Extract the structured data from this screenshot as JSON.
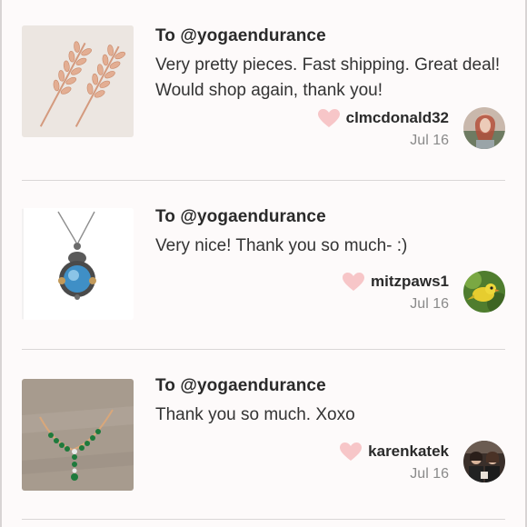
{
  "reviews": [
    {
      "to": "To @yogaendurance",
      "message": "Very pretty pieces. Fast shipping. Great deal! Would shop again, thank you!",
      "username": "clmcdonald32",
      "date": "Jul 16",
      "thumb_icon": "leaf-ear-cuff-earrings-image",
      "avatar_icon": "user-avatar-photo"
    },
    {
      "to": "To @yogaendurance",
      "message": "Very nice! Thank you so much- :)",
      "username": "mitzpaws1",
      "date": "Jul 16",
      "thumb_icon": "blue-stone-pendant-necklace-image",
      "avatar_icon": "bird-avatar-photo"
    },
    {
      "to": "To @yogaendurance",
      "message": "Thank you so much. Xoxo",
      "username": "karenkatek",
      "date": "Jul 16",
      "thumb_icon": "green-gem-necklace-image",
      "avatar_icon": "user-avatar-photo"
    }
  ],
  "colors": {
    "heart": "#f7c6c8",
    "background": "#fdfafa",
    "divider": "#d9d6d6",
    "date": "#8a8a8a"
  }
}
